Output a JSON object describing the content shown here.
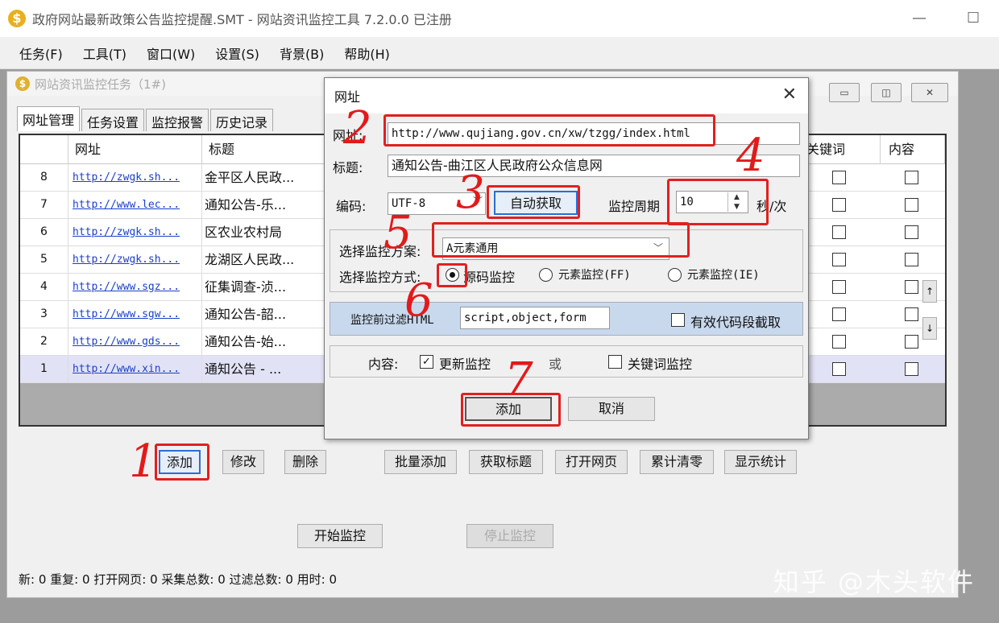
{
  "window": {
    "title": "政府网站最新政策公告监控提醒.SMT  - 网站资讯监控工具 7.2.0.0  已注册",
    "minimize": "—",
    "maximize": "☐"
  },
  "menu": [
    "任务(F)",
    "工具(T)",
    "窗口(W)",
    "设置(S)",
    "背景(B)",
    "帮助(H)"
  ],
  "inner_window": {
    "title": "网站资讯监控任务（1#)"
  },
  "tabs": [
    "网址管理",
    "任务设置",
    "监控报警",
    "历史记录"
  ],
  "grid": {
    "headers": {
      "url": "网址",
      "title": "标题",
      "keyword": "关键词",
      "content": "内容"
    },
    "rows": [
      {
        "num": "8",
        "url": "http://zwgk.sh...",
        "title": "金平区人民政..."
      },
      {
        "num": "7",
        "url": "http://www.lec...",
        "title": "通知公告-乐..."
      },
      {
        "num": "6",
        "url": "http://zwgk.sh...",
        "title": "区农业农村局"
      },
      {
        "num": "5",
        "url": "http://zwgk.sh...",
        "title": "龙湖区人民政..."
      },
      {
        "num": "4",
        "url": "http://www.sgz...",
        "title": "征集调查-浈..."
      },
      {
        "num": "3",
        "url": "http://www.sgw...",
        "title": "通知公告-韶..."
      },
      {
        "num": "2",
        "url": "http://www.gds...",
        "title": "通知公告-始..."
      },
      {
        "num": "1",
        "url": "http://www.xin...",
        "title": "通知公告 - ..."
      }
    ]
  },
  "buttons": {
    "add": "添加",
    "edit": "修改",
    "delete": "删除",
    "batch_add": "批量添加",
    "get_title": "获取标题",
    "open_page": "打开网页",
    "reset": "累计清零",
    "stats": "显示统计",
    "start": "开始监控",
    "stop": "停止监控"
  },
  "status": {
    "text": "新: 0  重复: 0  打开网页: 0  采集总数: 0  过滤总数: 0  用时: 0"
  },
  "watermark": "知乎 @木头软件",
  "dialog": {
    "title": "网址",
    "url_label": "网址:",
    "url_value": "http://www.qujiang.gov.cn/xw/tzgg/index.html",
    "title_label": "标题:",
    "title_value": "通知公告-曲江区人民政府公众信息网",
    "encoding_label": "编码:",
    "encoding_value": "UTF-8",
    "auto_button": "自动获取",
    "period_label": "监控周期",
    "period_value": "10",
    "period_unit": "秒/次",
    "scheme_label": "选择监控方案:",
    "scheme_value": "A元素通用",
    "mode_label": "选择监控方式:",
    "modes": [
      "源码监控",
      "元素监控(FF)",
      "元素监控(IE)"
    ],
    "filter_label": "监控前过滤HTML",
    "filter_value": "script,object,form",
    "valid_code": "有效代码段截取",
    "content_label": "内容:",
    "update_monitor": "更新监控",
    "or": "或",
    "keyword_monitor": "关键词监控",
    "add": "添加",
    "cancel": "取消"
  },
  "annotations": [
    "1",
    "2",
    "3",
    "4",
    "5",
    "6",
    "7"
  ]
}
